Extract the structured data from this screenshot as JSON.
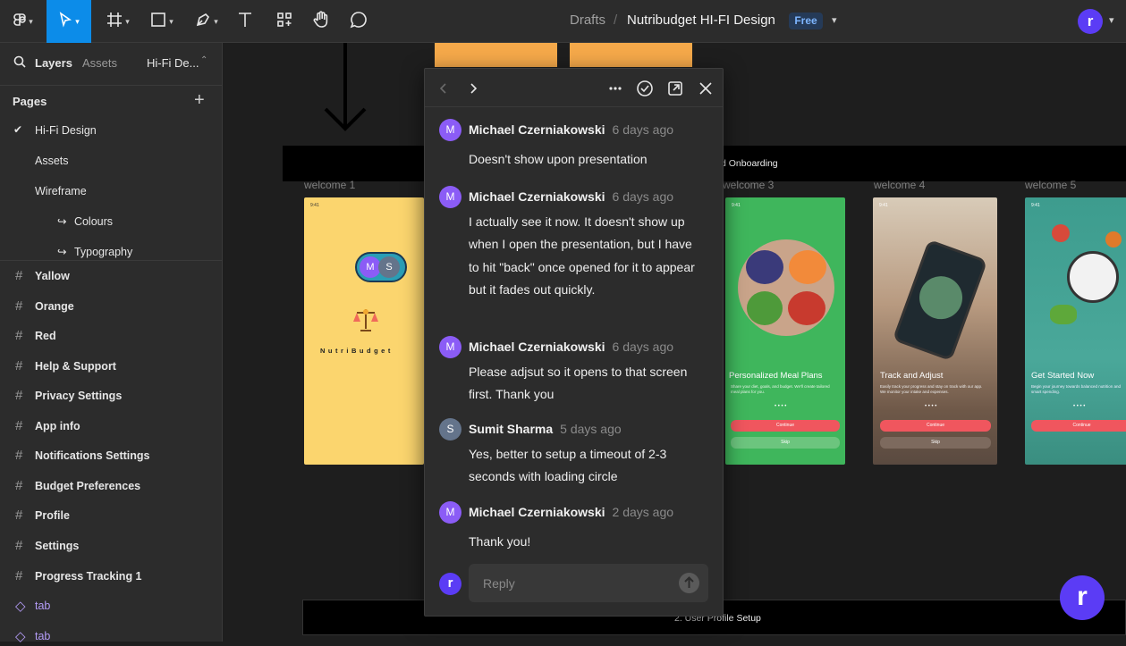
{
  "toolbar": {
    "breadcrumb_root": "Drafts",
    "separator": "/",
    "file_name": "Nutribudget HI-FI Design",
    "plan_badge": "Free",
    "user_initial": "r"
  },
  "sidebar": {
    "tabs": {
      "layers": "Layers",
      "assets": "Assets",
      "page_selector": "Hi-Fi De..."
    },
    "pages_heading": "Pages",
    "pages": [
      {
        "label": "Hi-Fi Design",
        "selected": true
      },
      {
        "label": "Assets"
      },
      {
        "label": "Wireframe"
      },
      {
        "label": "Colours",
        "prefix": "↪"
      },
      {
        "label": "Typography",
        "prefix": "↪"
      }
    ],
    "layers": [
      {
        "label": "Yallow",
        "icon": "frame-icon"
      },
      {
        "label": "Orange",
        "icon": "frame-icon"
      },
      {
        "label": "Red",
        "icon": "frame-icon"
      },
      {
        "label": "Help & Support",
        "icon": "frame-icon"
      },
      {
        "label": "Privacy Settings",
        "icon": "frame-icon"
      },
      {
        "label": "App info",
        "icon": "frame-icon"
      },
      {
        "label": "Notifications Settings",
        "icon": "frame-icon"
      },
      {
        "label": "Budget Preferences",
        "icon": "frame-icon"
      },
      {
        "label": "Profile",
        "icon": "frame-icon"
      },
      {
        "label": "Settings",
        "icon": "frame-icon"
      },
      {
        "label": "Progress Tracking 1",
        "icon": "frame-icon"
      },
      {
        "label": "tab",
        "icon": "component-icon"
      },
      {
        "label": "tab",
        "icon": "component-icon"
      }
    ]
  },
  "canvas": {
    "section_label_onboarding": "d Onboarding",
    "section_label_profile": "2. User Profile Setup",
    "frames": [
      {
        "label": "welcome 1",
        "app_name": "NutriBudget",
        "logo_letters": [
          "M",
          "S"
        ]
      },
      {
        "label": "welcome 3",
        "title": "Personalized Meal Plans",
        "subtitle": "Share your diet, goals, and budget. We'll create tailored meal plans for you.",
        "button": "Continue",
        "secondary_button": "Skip"
      },
      {
        "label": "welcome 4",
        "title": "Track and Adjust",
        "subtitle": "Easily track your progress and stay on track with our app. We monitor your intake and expenses.",
        "button": "Continue",
        "secondary_button": "Skip"
      },
      {
        "label": "welcome 5",
        "title": "Get Started Now",
        "subtitle": "Begin your journey towards balanced nutrition and smart spending.",
        "button": "Continue"
      }
    ],
    "status_time": "9:41"
  },
  "comments": {
    "thread": [
      {
        "initial": "M",
        "author": "Michael Czerniakowski",
        "time": "6 days ago",
        "text": "Doesn't show upon presentation",
        "color": "#8b5cf6"
      },
      {
        "initial": "M",
        "author": "Michael Czerniakowski",
        "time": "6 days ago",
        "text": "I actually see it now.  It doesn't show up when I open the presentation,  but I have to hit \"back\" once opened for it to appear but it fades out quickly.",
        "color": "#8b5cf6"
      },
      {
        "initial": "M",
        "author": "Michael Czerniakowski",
        "time": "6 days ago",
        "text": "Please adjsut so it opens to that screen first.  Thank you",
        "color": "#8b5cf6"
      },
      {
        "initial": "S",
        "author": "Sumit Sharma",
        "time": "5 days ago",
        "text": "Yes, better to setup a timeout of 2-3 seconds with loading circle",
        "color": "#64748b"
      },
      {
        "initial": "M",
        "author": "Michael Czerniakowski",
        "time": "2 days ago",
        "text": "Thank you!",
        "color": "#8b5cf6"
      }
    ],
    "reply_placeholder": "Reply",
    "reply_avatar": "r"
  },
  "colors": {
    "accent": "#0c8ce9",
    "user_avatar": "#5b3cf5",
    "welcome1_bg": "#fbd56e",
    "welcome3_bg": "#3fb65c",
    "cta_red": "#f0565e"
  }
}
